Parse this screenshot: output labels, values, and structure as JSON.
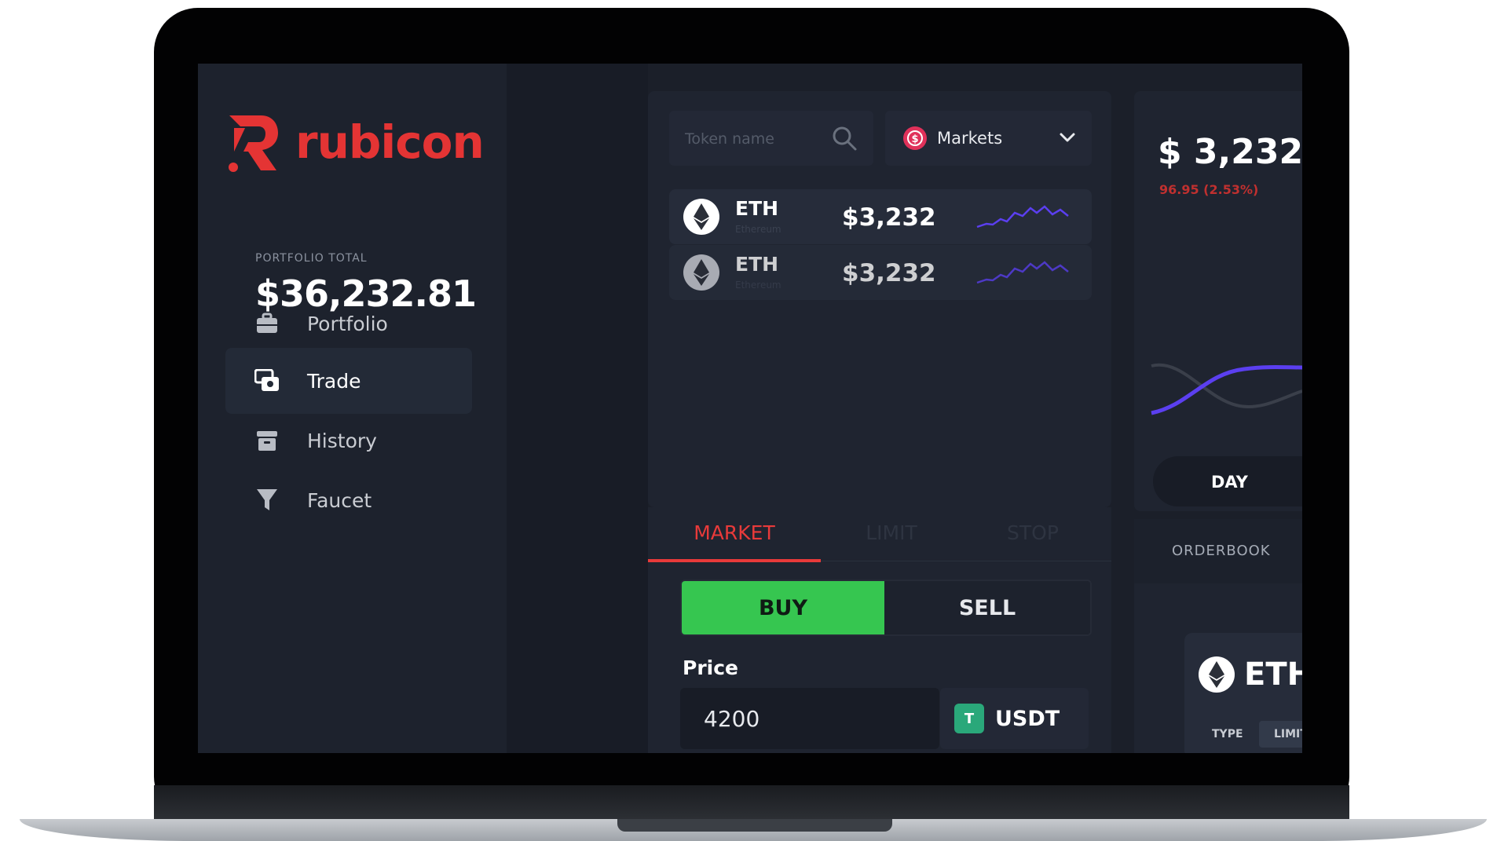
{
  "app": {
    "brand": "rubicon",
    "accent_color": "#e43434",
    "buy_color": "#36c650"
  },
  "portfolio": {
    "label": "PORTFOLIO TOTAL",
    "value": "$36,232.81"
  },
  "sidebar": {
    "items": [
      {
        "label": "Portfolio",
        "icon": "briefcase-icon",
        "active": false
      },
      {
        "label": "Trade",
        "icon": "trade-icon",
        "active": true
      },
      {
        "label": "History",
        "icon": "archive-icon",
        "active": false
      },
      {
        "label": "Faucet",
        "icon": "faucet-icon",
        "active": false
      }
    ]
  },
  "search": {
    "placeholder": "Token name",
    "icon": "search-icon"
  },
  "markets_select": {
    "label": "Markets",
    "icon": "chevron-down-icon"
  },
  "tokens": [
    {
      "symbol": "ETH",
      "name": "Ethereum",
      "price": "$3,232"
    },
    {
      "symbol": "ETH",
      "name": "Ethereum",
      "price": "$3,232"
    }
  ],
  "order": {
    "tabs": [
      "MARKET",
      "LIMIT",
      "STOP"
    ],
    "active_tab": "MARKET",
    "buy_label": "BUY",
    "sell_label": "SELL",
    "price_label": "Price",
    "price_value": "4200",
    "currency": "USDT",
    "currency_badge": "T"
  },
  "ticker": {
    "price": "$ 3,232",
    "change": "96.95 (2.53%)",
    "range_button": "DAY"
  },
  "orderbook": {
    "title": "ORDERBOOK",
    "token": "ETH",
    "type_label": "TYPE",
    "type_value": "LIMIT"
  }
}
